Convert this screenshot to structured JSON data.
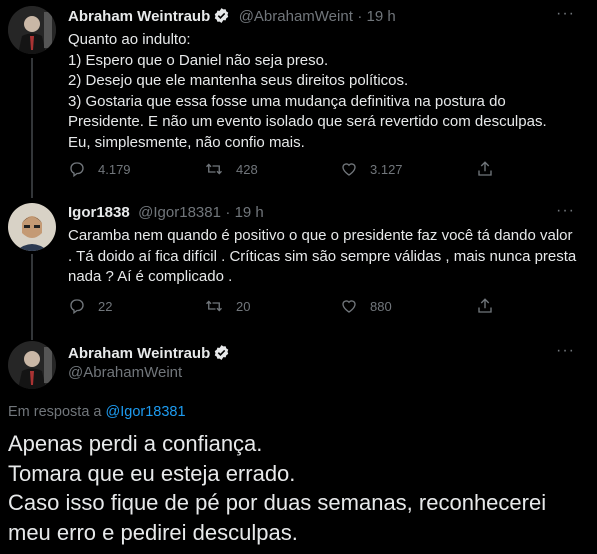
{
  "tweets": [
    {
      "display_name": "Abraham Weintraub",
      "handle": "@AbrahamWeint",
      "time": "· 19 h",
      "text": "Quanto ao indulto:\n1) Espero que o Daniel não seja preso.\n2) Desejo que ele mantenha seus direitos políticos.\n3) Gostaria que essa fosse uma mudança definitiva na postura do Presidente. E não um evento isolado que será revertido com desculpas.\nEu, simplesmente, não confio mais.",
      "replies": "4.179",
      "retweets": "428",
      "likes": "3.127"
    },
    {
      "display_name": "Igor1838",
      "handle": "@Igor18381",
      "time": "· 19 h",
      "text": "Caramba nem quando é positivo o que o presidente faz você tá dando valor . Tá doido aí fica difícil . Críticas sim são sempre válidas , mais nunca presta nada ? Aí é complicado .",
      "replies": "22",
      "retweets": "20",
      "likes": "880"
    }
  ],
  "main_tweet": {
    "display_name": "Abraham Weintraub",
    "handle": "@AbrahamWeint",
    "reply_prefix": "Em resposta a",
    "reply_to": "@Igor18381",
    "text": "Apenas perdi a confiança.\nTomara que eu esteja errado.\nCaso isso fique de pé por duas semanas, reconhecerei meu erro e pedirei desculpas."
  },
  "colors": {
    "background": "#000000",
    "text": "#e7e9ea",
    "muted": "#71767b",
    "accent": "#1d9bf0",
    "thread_line": "#333639"
  },
  "icons": [
    "verified-badge-icon",
    "more-options-icon",
    "reply-icon",
    "retweet-icon",
    "like-icon",
    "share-icon"
  ]
}
